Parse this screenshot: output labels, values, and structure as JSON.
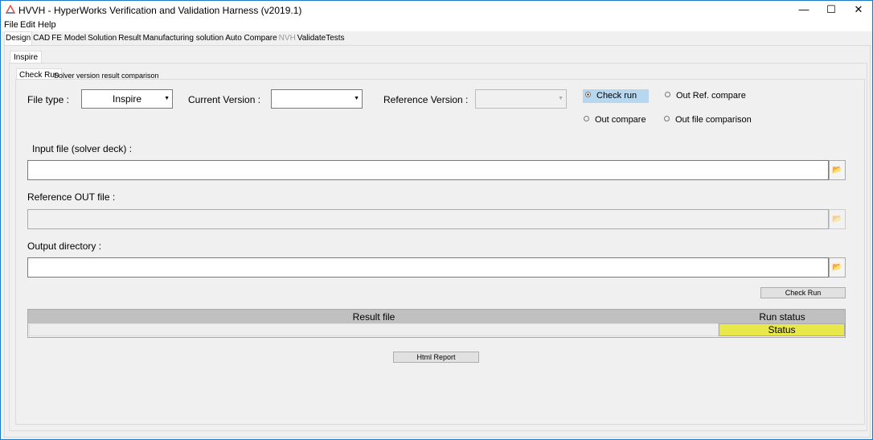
{
  "window": {
    "title": "HVVH - HyperWorks Verification and Validation Harness (v2019.1)",
    "minimize": "—",
    "maximize": "☐",
    "close": "✕"
  },
  "menu": [
    "File",
    "Edit",
    "Help"
  ],
  "tabs": [
    {
      "label": "Design",
      "state": "selected"
    },
    {
      "label": "CAD"
    },
    {
      "label": "FE Model"
    },
    {
      "label": "Solution"
    },
    {
      "label": "Result"
    },
    {
      "label": "Manufacturing solution"
    },
    {
      "label": "Auto Compare"
    },
    {
      "label": "NVH",
      "state": "disabled"
    },
    {
      "label": "ValidateTests"
    }
  ],
  "subtab": "Inspire",
  "innertabs": [
    "Check Run",
    "Solver version result comparison"
  ],
  "form": {
    "file_type_label": "File type :",
    "file_type_value": "Inspire",
    "current_version_label": "Current Version  :",
    "current_version_value": "",
    "reference_version_label": "Reference Version :",
    "reference_version_value": "",
    "radios": [
      "Check run",
      "Out Ref. compare",
      "Out compare",
      "Out file comparison"
    ],
    "selected_radio": "Check run",
    "input_file_label": "Input file (solver deck) :",
    "ref_out_label": "Reference OUT file :",
    "output_dir_label": "Output directory :",
    "check_run_button": "Check Run"
  },
  "table": {
    "headers": [
      "Result file",
      "Run status"
    ],
    "rows": [
      {
        "file": "",
        "status": "Status"
      }
    ]
  },
  "html_report_button": "Html Report",
  "colors": {
    "accent": "#1979ca",
    "selected_radio_bg": "#b6d7ee",
    "status_bg": "#e8e84a",
    "header_bg": "#c0c0c0"
  }
}
